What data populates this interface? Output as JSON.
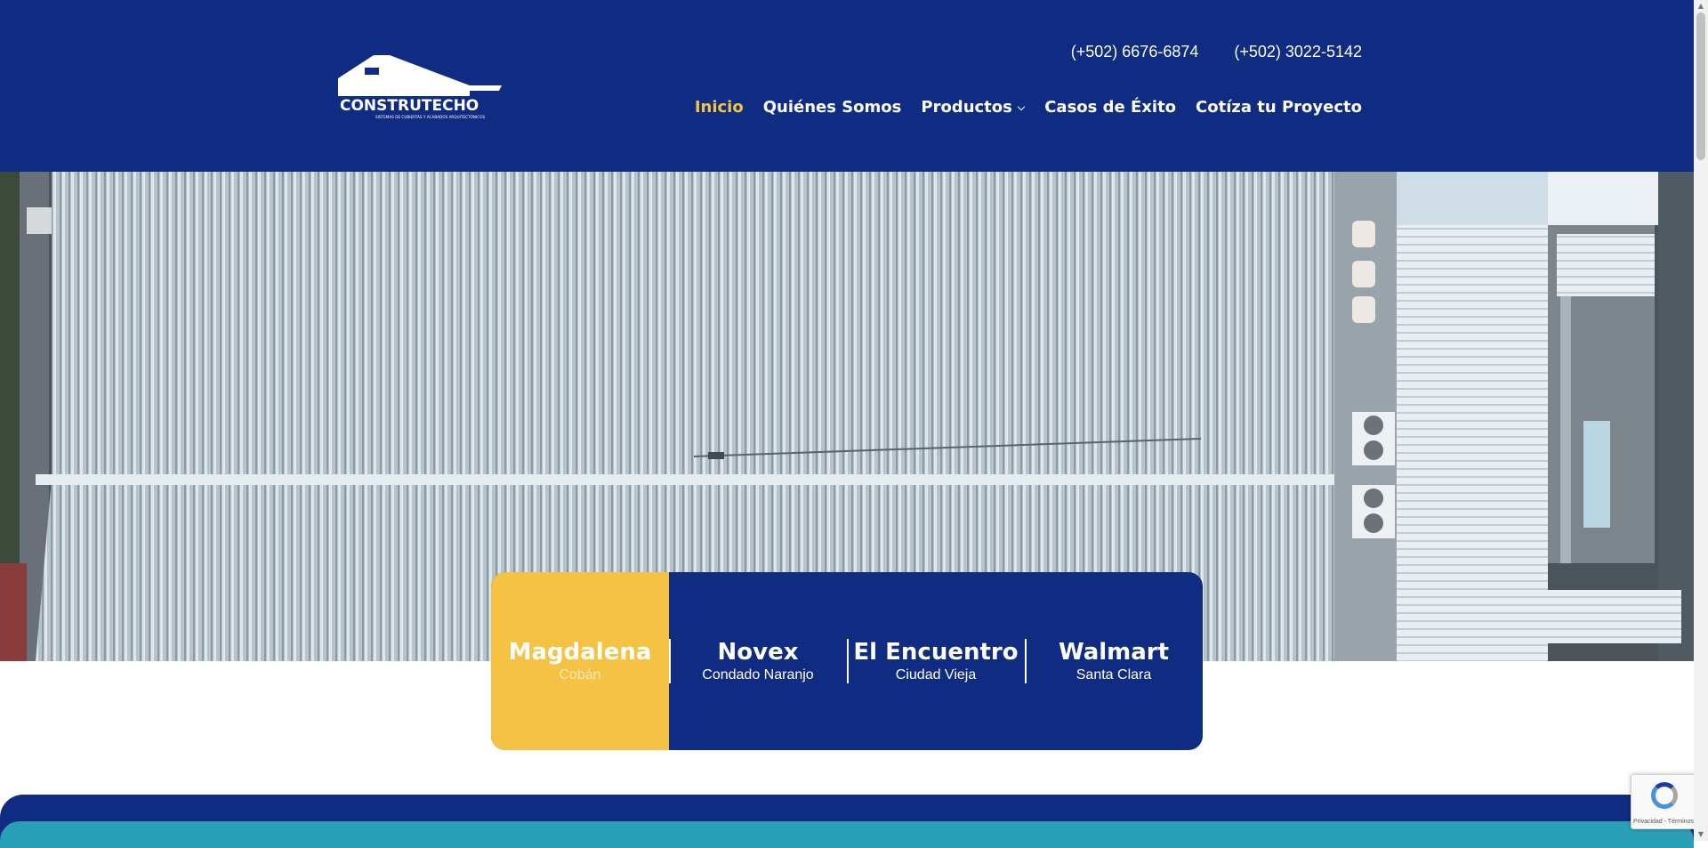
{
  "brand": {
    "name": "CONSTRUTECHO",
    "tagline": "SISTEMAS DE CUBIERTAS Y ACABADOS ARQUITECTÓNICOS"
  },
  "header": {
    "phones": [
      "(+502) 6676-6874",
      "(+502) 3022-5142"
    ],
    "nav": [
      {
        "label": "Inicio",
        "active": true
      },
      {
        "label": "Quiénes Somos"
      },
      {
        "label": "Productos",
        "dropdown": true
      },
      {
        "label": "Casos de Éxito"
      },
      {
        "label": "Cotíza tu Proyecto"
      }
    ]
  },
  "tabs": [
    {
      "title": "Magdalena",
      "subtitle": "Cobán",
      "active": true
    },
    {
      "title": "Novex",
      "subtitle": "Condado Naranjo"
    },
    {
      "title": "El Encuentro",
      "subtitle": "Ciudad Vieja"
    },
    {
      "title": "Walmart",
      "subtitle": "Santa Clara"
    }
  ],
  "recaptcha": {
    "footer": "Privacidad - Términos"
  },
  "colors": {
    "primary": "#102b82",
    "accent": "#f4c343",
    "teal": "#2aa0b6"
  }
}
